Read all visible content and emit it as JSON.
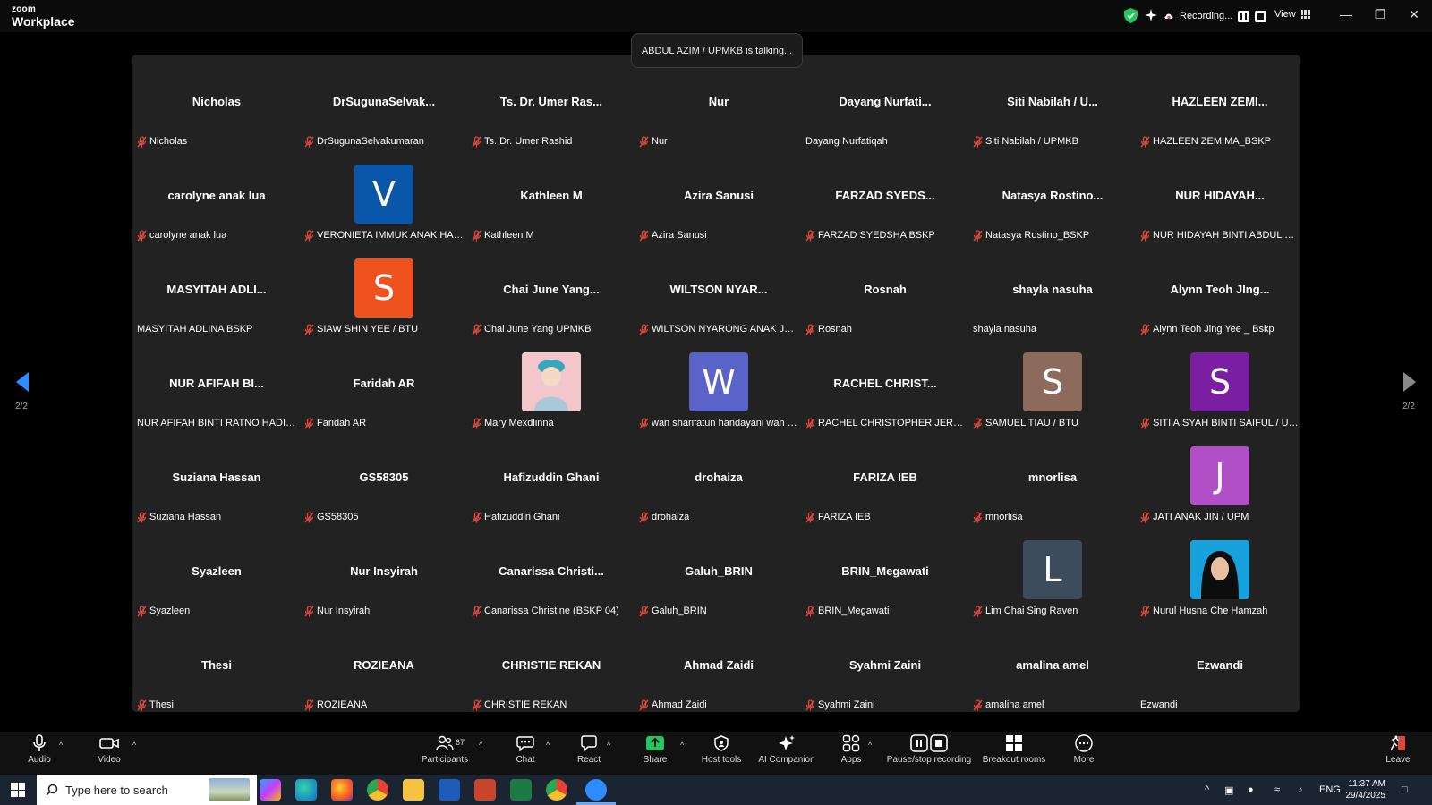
{
  "app": {
    "brand_top": "zoom",
    "brand_bottom": "Workplace"
  },
  "titlebar": {
    "recording_label": "Recording...",
    "view_label": "View"
  },
  "talking_banner": "ABDUL AZIM / UPMKB is talking...",
  "navigation": {
    "page_left": "2/2",
    "page_right": "2/2"
  },
  "participants_grid": [
    {
      "name": "Nicholas",
      "label": "Nicholas",
      "muted": true
    },
    {
      "name": "DrSugunaSelvak...",
      "label": "DrSugunaSelvakumaran",
      "muted": true
    },
    {
      "name": "Ts. Dr. Umer Ras...",
      "label": "Ts. Dr. Umer Rashid",
      "muted": true
    },
    {
      "name": "Nur",
      "label": "Nur",
      "muted": true
    },
    {
      "name": "Dayang  Nurfati...",
      "label": "Dayang Nurfatiqah",
      "muted": false
    },
    {
      "name": "Siti Nabilah / U...",
      "label": "Siti Nabilah / UPMKB",
      "muted": true
    },
    {
      "name": "HAZLEEN ZEMI...",
      "label": "HAZLEEN ZEMIMA_BSKP",
      "muted": true
    },
    {
      "name": "carolyne anak lua",
      "label": "carolyne anak lua",
      "muted": true
    },
    {
      "name": "",
      "avatar": "V",
      "avatar_color": "#0a56a8",
      "label": "VERONIETA IMMUK ANAK HARR...",
      "muted": true
    },
    {
      "name": "Kathleen M",
      "label": "Kathleen M",
      "muted": true
    },
    {
      "name": "Azira Sanusi",
      "label": "Azira Sanusi",
      "muted": true
    },
    {
      "name": "FARZAD  SYEDS...",
      "label": "FARZAD SYEDSHA BSKP",
      "muted": true
    },
    {
      "name": "Natasya Rostino...",
      "label": "Natasya Rostino_BSKP",
      "muted": true
    },
    {
      "name": "NUR HIDAYAH...",
      "label": "NUR HIDAYAH BINTI ABDUL HALI...",
      "muted": true
    },
    {
      "name": "MASYITAH  ADLI...",
      "label": "MASYITAH ADLINA BSKP",
      "muted": false
    },
    {
      "name": "",
      "avatar": "S",
      "avatar_color": "#f0521f",
      "label": "SIAW SHIN YEE / BTU",
      "muted": true
    },
    {
      "name": "Chai June Yang...",
      "label": "Chai June Yang UPMKB",
      "muted": true
    },
    {
      "name": "WILTSON  NYAR...",
      "label": "WILTSON NYARONG ANAK JOST...",
      "muted": true
    },
    {
      "name": "Rosnah",
      "label": "Rosnah",
      "muted": true
    },
    {
      "name": "shayla nasuha",
      "label": "shayla nasuha",
      "muted": false
    },
    {
      "name": "Alynn Teoh JIng...",
      "label": "Alynn Teoh Jing Yee _ Bskp",
      "muted": true
    },
    {
      "name": "NUR AFIFAH BI...",
      "label": "NUR AFIFAH BINTI RATNO HADIYO...",
      "muted": false
    },
    {
      "name": "Faridah AR",
      "label": "Faridah AR",
      "muted": true
    },
    {
      "name": "",
      "avatar": "photo-girl",
      "avatar_color": "#f2c2c8",
      "label": "Mary Mexdlinna",
      "muted": true
    },
    {
      "name": "",
      "avatar": "W",
      "avatar_color": "#5a63c8",
      "label": "wan sharifatun handayani wan z...",
      "muted": true
    },
    {
      "name": "RACHEL  CHRIST...",
      "label": "RACHEL CHRISTOPHER JERRY / ...",
      "muted": true
    },
    {
      "name": "",
      "avatar": "S",
      "avatar_color": "#8c6a5c",
      "label": "SAMUEL TIAU / BTU",
      "muted": true
    },
    {
      "name": "",
      "avatar": "S",
      "avatar_color": "#7b1fa2",
      "label": "SITI AISYAH BINTI SAIFUL / UPM",
      "muted": true
    },
    {
      "name": "Suziana Hassan",
      "label": "Suziana Hassan",
      "muted": true
    },
    {
      "name": "GS58305",
      "label": "GS58305",
      "muted": true
    },
    {
      "name": "Hafizuddin Ghani",
      "label": "Hafizuddin Ghani",
      "muted": true
    },
    {
      "name": "drohaiza",
      "label": "drohaiza",
      "muted": true
    },
    {
      "name": "FARIZA IEB",
      "label": "FARIZA IEB",
      "muted": true
    },
    {
      "name": "mnorlisa",
      "label": "mnorlisa",
      "muted": true
    },
    {
      "name": "",
      "avatar": "J",
      "avatar_color": "#b04fc6",
      "label": "JATI ANAK JIN / UPM",
      "muted": true
    },
    {
      "name": "Syazleen",
      "label": "Syazleen",
      "muted": true
    },
    {
      "name": "Nur Insyirah",
      "label": "Nur Insyirah",
      "muted": true
    },
    {
      "name": "Canarissa  Christi...",
      "label": "Canarissa Christine (BSKP 04)",
      "muted": true
    },
    {
      "name": "Galuh_BRIN",
      "label": "Galuh_BRIN",
      "muted": true
    },
    {
      "name": "BRIN_Megawati",
      "label": "BRIN_Megawati",
      "muted": true
    },
    {
      "name": "",
      "avatar": "L",
      "avatar_color": "#3c4c5a",
      "label": "Lim Chai Sing Raven",
      "muted": true
    },
    {
      "name": "",
      "avatar": "photo-hijab",
      "avatar_color": "#1aa0d8",
      "label": "Nurul Husna Che Hamzah",
      "muted": true
    },
    {
      "name": "Thesi",
      "label": "Thesi",
      "muted": true
    },
    {
      "name": "ROZIEANA",
      "label": "ROZIEANA",
      "muted": true
    },
    {
      "name": "CHRISTIE REKAN",
      "label": "CHRISTIE REKAN",
      "muted": true
    },
    {
      "name": "Ahmad Zaidi",
      "label": "Ahmad Zaidi",
      "muted": true
    },
    {
      "name": "Syahmi Zaini",
      "label": "Syahmi Zaini",
      "muted": true
    },
    {
      "name": "amalina amel",
      "label": "amalina amel",
      "muted": true
    },
    {
      "name": "Ezwandi",
      "label": "Ezwandi",
      "muted": false
    }
  ],
  "toolbar": {
    "audio": "Audio",
    "video": "Video",
    "participants": "Participants",
    "participants_count": "67",
    "chat": "Chat",
    "react": "React",
    "share": "Share",
    "host_tools": "Host tools",
    "ai_companion": "AI Companion",
    "apps": "Apps",
    "pause_stop_recording": "Pause/stop recording",
    "breakout_rooms": "Breakout rooms",
    "more": "More",
    "leave": "Leave"
  },
  "taskbar": {
    "search_placeholder": "Type here to search",
    "language": "ENG",
    "time": "11:37 AM",
    "date": "29/4/2025"
  },
  "colors": {
    "share_green": "#22c55e",
    "accent_blue": "#0e72ed",
    "muted_red": "#e0483e"
  }
}
